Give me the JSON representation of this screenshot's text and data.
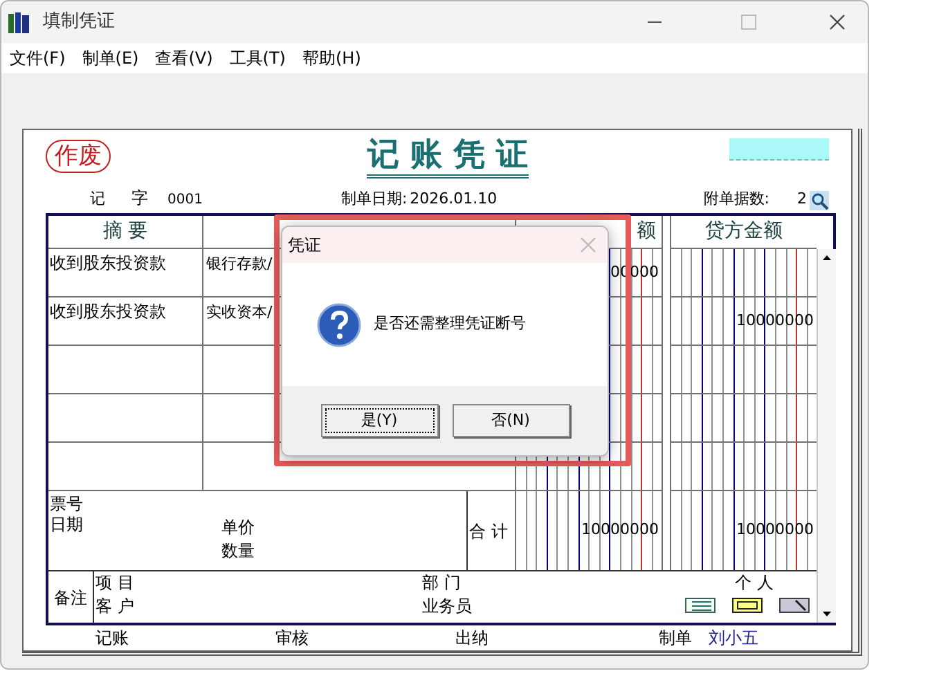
{
  "window": {
    "title": "填制凭证"
  },
  "menu": [
    "文件(F)",
    "制单(E)",
    "查看(V)",
    "工具(T)",
    "帮助(H)"
  ],
  "voucher": {
    "void_stamp": "作废",
    "title": "记 账 凭 证",
    "type_label": "记",
    "word_label": "字",
    "number": "0001",
    "date_label": "制单日期:",
    "date": "2026.01.10",
    "attachments_label": "附单据数:",
    "attachments": "2"
  },
  "table": {
    "columns": [
      "摘 要",
      "额",
      "贷方金额"
    ],
    "rows": [
      {
        "summary": "收到股东投资款",
        "account": "银行存款/",
        "debit": "00000",
        "credit": ""
      },
      {
        "summary": "收到股东投资款",
        "account": "实收资本/",
        "debit": "",
        "credit": "10000000"
      }
    ]
  },
  "footer": {
    "ticket_label": "票号",
    "date_label": "日期",
    "price_label": "单价",
    "qty_label": "数量",
    "total_label": "合 计",
    "debit_total": "10000000",
    "credit_total": "10000000"
  },
  "notes": {
    "label": "备注",
    "project_label": "项 目",
    "customer_label": "客 户",
    "dept_label": "部 门",
    "salesperson_label": "业务员",
    "person_label": "个 人"
  },
  "signatures": [
    {
      "label": "记账"
    },
    {
      "label": "审核"
    },
    {
      "label": "出纳"
    },
    {
      "label": "制单",
      "value": "刘小五"
    }
  ],
  "dialog": {
    "title": "凭证",
    "message": "是否还需整理凭证断号",
    "buttons": [
      {
        "label": "是(Y)",
        "selected": true
      },
      {
        "label": "否(N)",
        "selected": false
      }
    ]
  }
}
